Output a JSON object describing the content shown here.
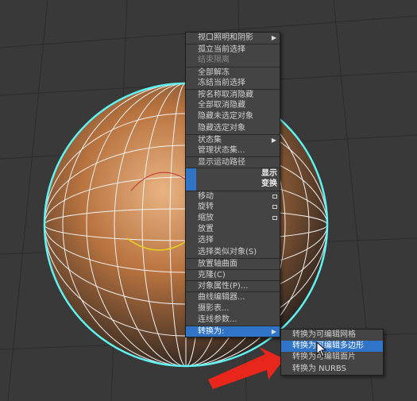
{
  "quad_menu": {
    "items": [
      {
        "label": "视口照明和阴影",
        "submenu": true
      },
      {
        "label": "孤立当前选择",
        "sep": true
      },
      {
        "label": "结束隔离",
        "disabled": true
      },
      {
        "label": "全部解冻",
        "sep": true
      },
      {
        "label": "冻结当前选择"
      },
      {
        "label": "按名称取消隐藏",
        "sep": true
      },
      {
        "label": "全部取消隐藏"
      },
      {
        "label": "隐藏未选定对象"
      },
      {
        "label": "隐藏选定对象"
      },
      {
        "label": "状态集",
        "submenu": true,
        "sep": true
      },
      {
        "label": "管理状态集..."
      },
      {
        "label": "显示运动路径",
        "sep": true
      },
      {
        "label": "显示",
        "bar": true,
        "sep": true
      },
      {
        "label": "变换",
        "bar": true
      }
    ],
    "items_b": [
      {
        "label": "移动",
        "option": true,
        "sep": true
      },
      {
        "label": "旋转",
        "option": true
      },
      {
        "label": "缩放",
        "option": true
      },
      {
        "label": "放置"
      },
      {
        "label": "选择"
      },
      {
        "label": "选择类似对象(S)"
      },
      {
        "label": "放置轴曲面",
        "sep": true
      },
      {
        "label": "克隆(C)",
        "sep": true
      },
      {
        "label": "对象属性(P)...",
        "sep": true
      },
      {
        "label": "曲线编辑器...",
        "sep": true
      },
      {
        "label": "摄影表..."
      },
      {
        "label": "连线参数..."
      },
      {
        "label": "转换为:",
        "submenu": true,
        "highlighted": true,
        "sep": true
      }
    ]
  },
  "submenu": {
    "items": [
      {
        "label": "转换为可编辑网格"
      },
      {
        "label": "转换为可编辑多边形",
        "highlighted": true
      },
      {
        "label": "转换为可编辑面片"
      },
      {
        "label": "转换为 NURBS"
      }
    ]
  },
  "colors": {
    "accent": "#2f74c7",
    "arrow": "#e8261c",
    "selection": "#5ff2f2",
    "sphere": "#c98a55"
  }
}
